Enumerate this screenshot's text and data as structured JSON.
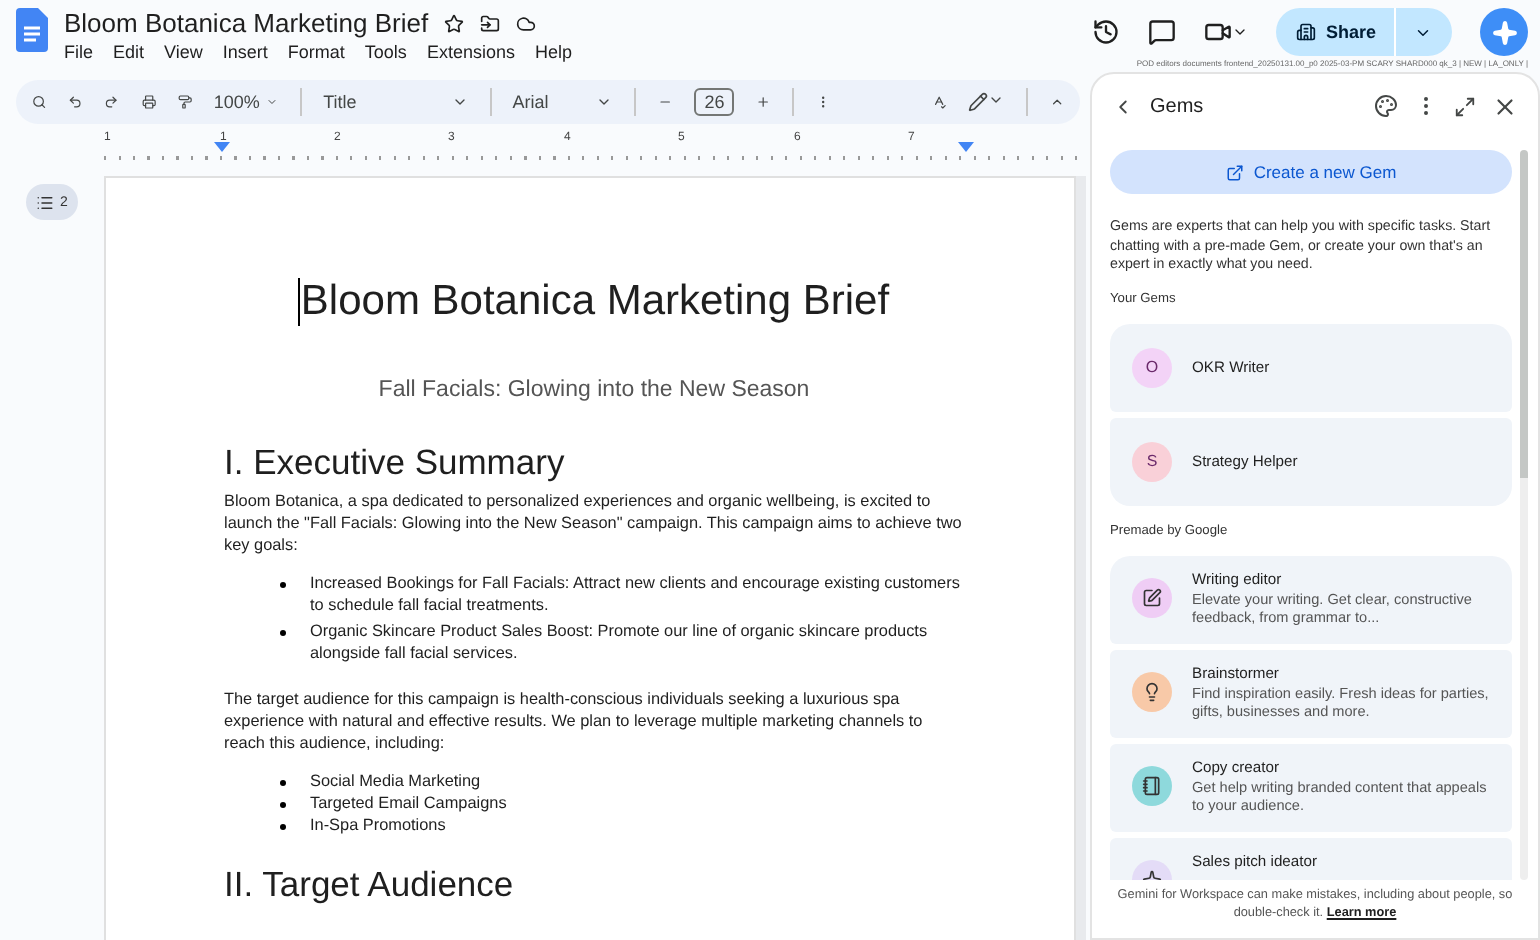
{
  "window": {
    "title": "Bloom Botanica Marketing Brief",
    "menu": [
      "File",
      "Edit",
      "View",
      "Insert",
      "Format",
      "Tools",
      "Extensions",
      "Help"
    ],
    "share": "Share",
    "build_info": "POD editors documents frontend_20250131.00_p0 2025-03-PM SCARY SHARD000 qk_3 | NEW | LA_ONLY |"
  },
  "toolbar": {
    "zoom": "100%",
    "style": "Title",
    "font": "Arial",
    "font_size": "26"
  },
  "ruler": {
    "labels": [
      "1",
      "1",
      "2",
      "3",
      "4",
      "5",
      "6",
      "7"
    ]
  },
  "outline": {
    "count": "2"
  },
  "document": {
    "blocks": [
      {
        "kind": "title",
        "text": "Bloom Botanica Marketing Brief"
      },
      {
        "kind": "subtitle",
        "text": "Fall Facials: Glowing into the New Season"
      },
      {
        "kind": "heading",
        "text": "I. Executive Summary"
      },
      {
        "kind": "paragraph",
        "text": "Bloom Botanica, a spa dedicated to personalized experiences and organic wellbeing, is excited to launch the \"Fall Facials: Glowing into the New Season\" campaign. This campaign aims to achieve two key goals:"
      },
      {
        "kind": "bullets",
        "spaced": true,
        "items": [
          "Increased Bookings for Fall Facials: Attract new clients and encourage existing customers to schedule fall facial treatments.",
          "Organic Skincare Product Sales Boost:  Promote our line of organic skincare products alongside fall facial services."
        ]
      },
      {
        "kind": "paragraph",
        "text": "The target audience for this campaign is health-conscious individuals seeking a luxurious spa experience with natural and effective results. We plan to leverage multiple marketing channels to reach this audience, including:"
      },
      {
        "kind": "bullets",
        "spaced": false,
        "items": [
          "Social Media Marketing",
          "Targeted Email Campaigns",
          "In-Spa Promotions"
        ]
      },
      {
        "kind": "heading",
        "text": "II. Target Audience"
      }
    ]
  },
  "gems_panel": {
    "title": "Gems",
    "create_button": "Create a new Gem",
    "intro": "Gems are experts that can help you with specific tasks. Start chatting with a pre-made Gem, or create your own that's an expert in exactly what you need.",
    "your_gems_heading": "Your Gems",
    "your_gems": [
      {
        "initial": "O",
        "name": "OKR Writer",
        "color": "#f3d3f7"
      },
      {
        "initial": "S",
        "name": "Strategy Helper",
        "color": "#f9d0d8"
      }
    ],
    "premade_heading": "Premade by Google",
    "premade": [
      {
        "kind": "edit",
        "name": "Writing editor",
        "description": "Elevate your writing. Get clear, constructive feedback, from grammar to...",
        "color": "#efcdf5"
      },
      {
        "kind": "idea",
        "name": "Brainstormer",
        "description": "Find inspiration easily. Fresh ideas for parties, gifts, businesses and more.",
        "color": "#f8c9a8"
      },
      {
        "kind": "copy",
        "name": "Copy creator",
        "description": "Get help writing branded content that appeals to your audience.",
        "color": "#8ed9dc"
      },
      {
        "kind": "pitch",
        "name": "Sales pitch ideator",
        "color": "#e4dcf7"
      }
    ],
    "footer": {
      "text": "Gemini for Workspace can make mistakes, including about people, so double-check it.",
      "link": "Learn more"
    }
  }
}
